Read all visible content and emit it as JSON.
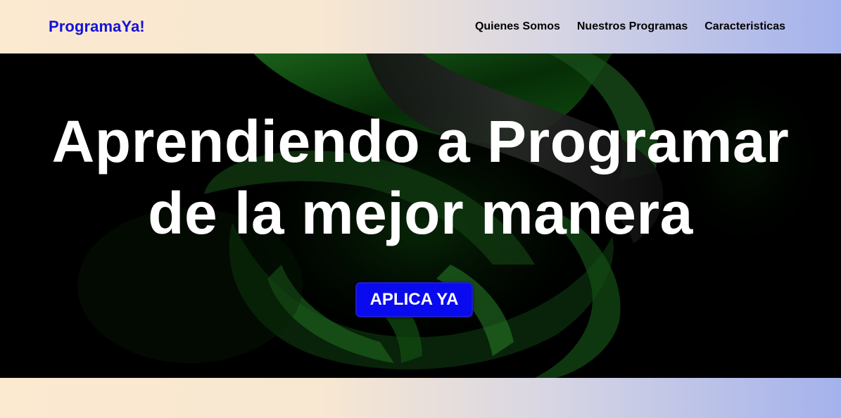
{
  "header": {
    "logo": "ProgramaYa!",
    "nav": [
      {
        "label": "Quienes Somos"
      },
      {
        "label": "Nuestros Programas"
      },
      {
        "label": "Caracteristicas"
      }
    ]
  },
  "hero": {
    "title_line1": "Aprendiendo a Programar",
    "title_line2": "de la mejor manera",
    "cta_label": "APLICA YA"
  },
  "colors": {
    "brand": "#1414d8",
    "cta_background": "#0a0aef",
    "hero_accent": "#1f8f1f",
    "gradient_start": "#fbe9d0",
    "gradient_end": "#a4b2ec"
  }
}
